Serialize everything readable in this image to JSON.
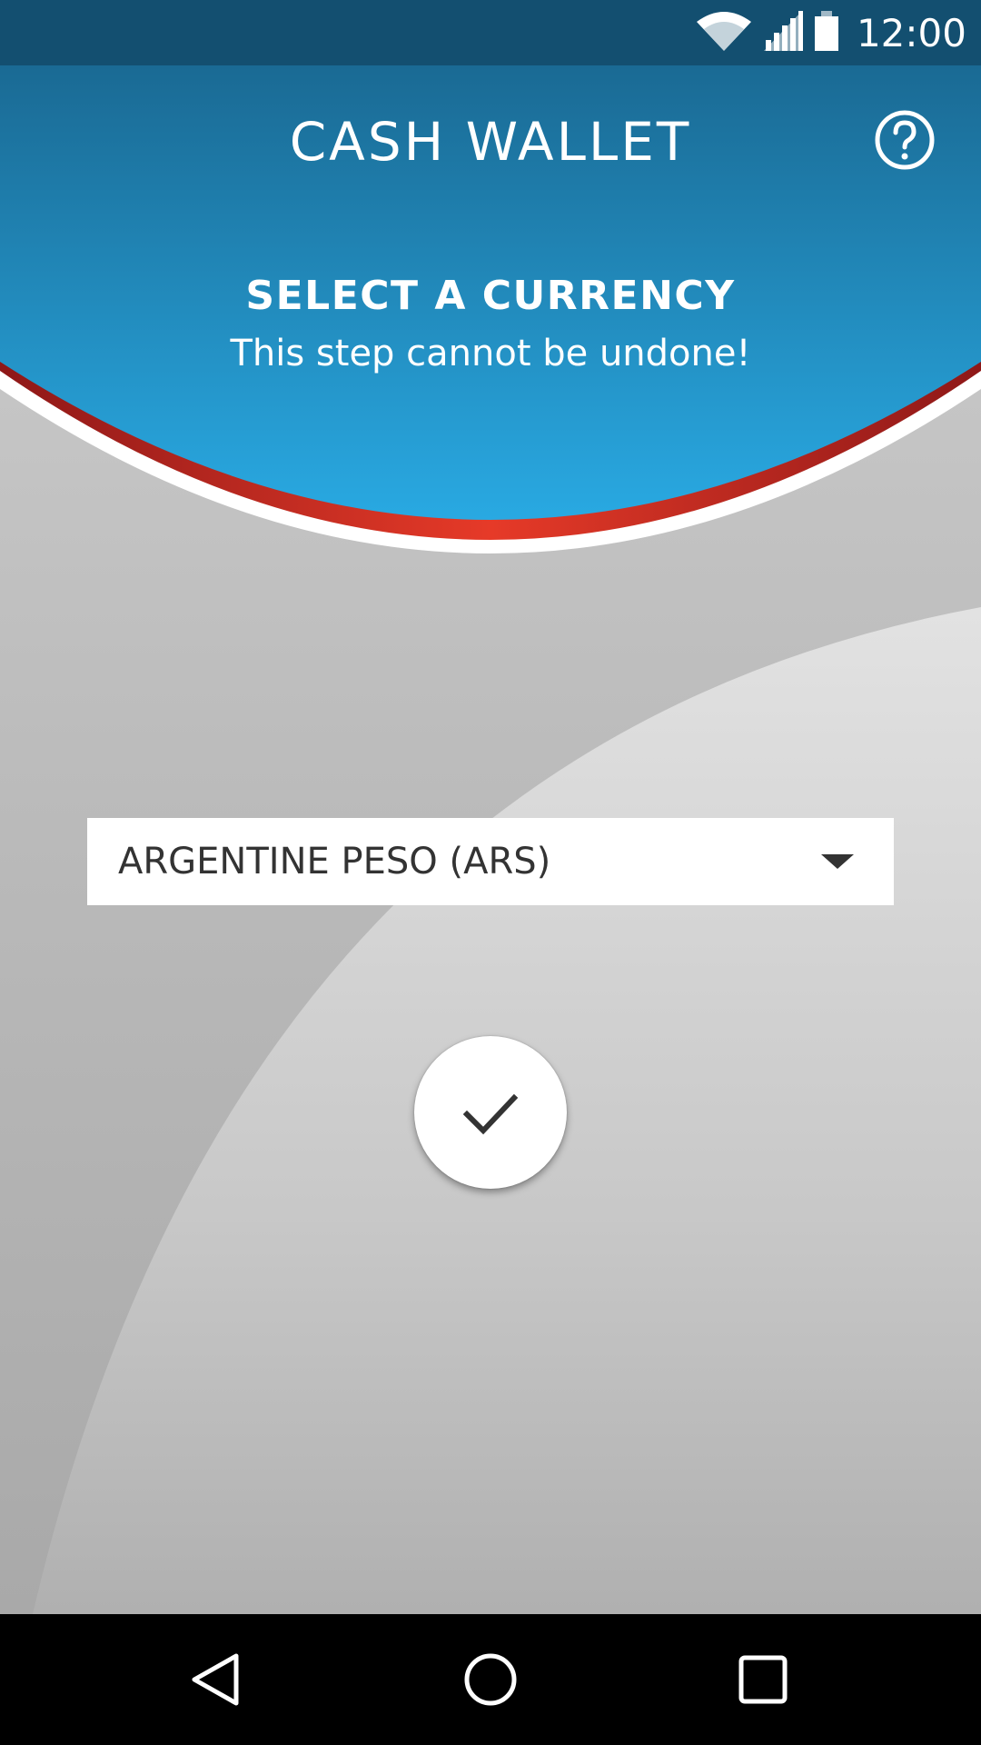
{
  "status_bar": {
    "time": "12:00",
    "icons": [
      "wifi-icon",
      "signal-icon",
      "battery-icon"
    ]
  },
  "header": {
    "title": "CASH WALLET",
    "help_icon": "help-circle-icon"
  },
  "step": {
    "title": "SELECT A CURRENCY",
    "subtitle": "This step cannot be undone!"
  },
  "currency_select": {
    "selected": "ARGENTINE PESO (ARS)"
  },
  "confirm_icon": "checkmark-icon",
  "nav_bar": {
    "icons": [
      "back-icon",
      "home-icon",
      "recents-icon"
    ]
  },
  "colors": {
    "status_bar": "#134f70",
    "header_top": "#1a6d97",
    "header_bottom": "#29a8e1",
    "red_accent": "#e03426",
    "dark_red": "#9a1b1b",
    "background": "#b8b8b8"
  }
}
